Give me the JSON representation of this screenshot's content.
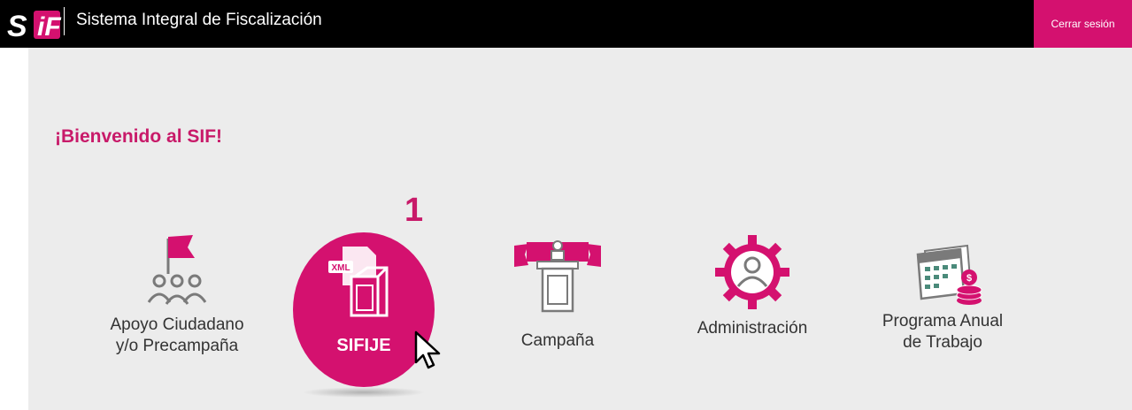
{
  "header": {
    "app_title": "Sistema Integral de Fiscalización",
    "logout_label": "Cerrar sesión",
    "logo_text": "SIF"
  },
  "welcome": "¡Bienvenido al SIF!",
  "step_marker": "1",
  "modules": [
    {
      "id": "apoyo",
      "lines": [
        "Apoyo Ciudadano",
        "y/o Precampaña"
      ],
      "icon": "flag-people-icon"
    },
    {
      "id": "sifije",
      "lines": [
        "SIFIJE"
      ],
      "icon": "xml-ballot-box-icon",
      "xml_badge": "XML"
    },
    {
      "id": "campana",
      "lines": [
        "Campaña"
      ],
      "icon": "podium-banner-icon"
    },
    {
      "id": "admin",
      "lines": [
        "Administración"
      ],
      "icon": "user-gear-icon"
    },
    {
      "id": "programa",
      "lines": [
        "Programa Anual",
        "de Trabajo"
      ],
      "icon": "calendar-coins-icon"
    }
  ],
  "colors": {
    "accent": "#d4116f",
    "heading": "#c81a69",
    "icon_gray": "#7a7a7a",
    "background": "#ececec",
    "topbar": "#000000"
  }
}
